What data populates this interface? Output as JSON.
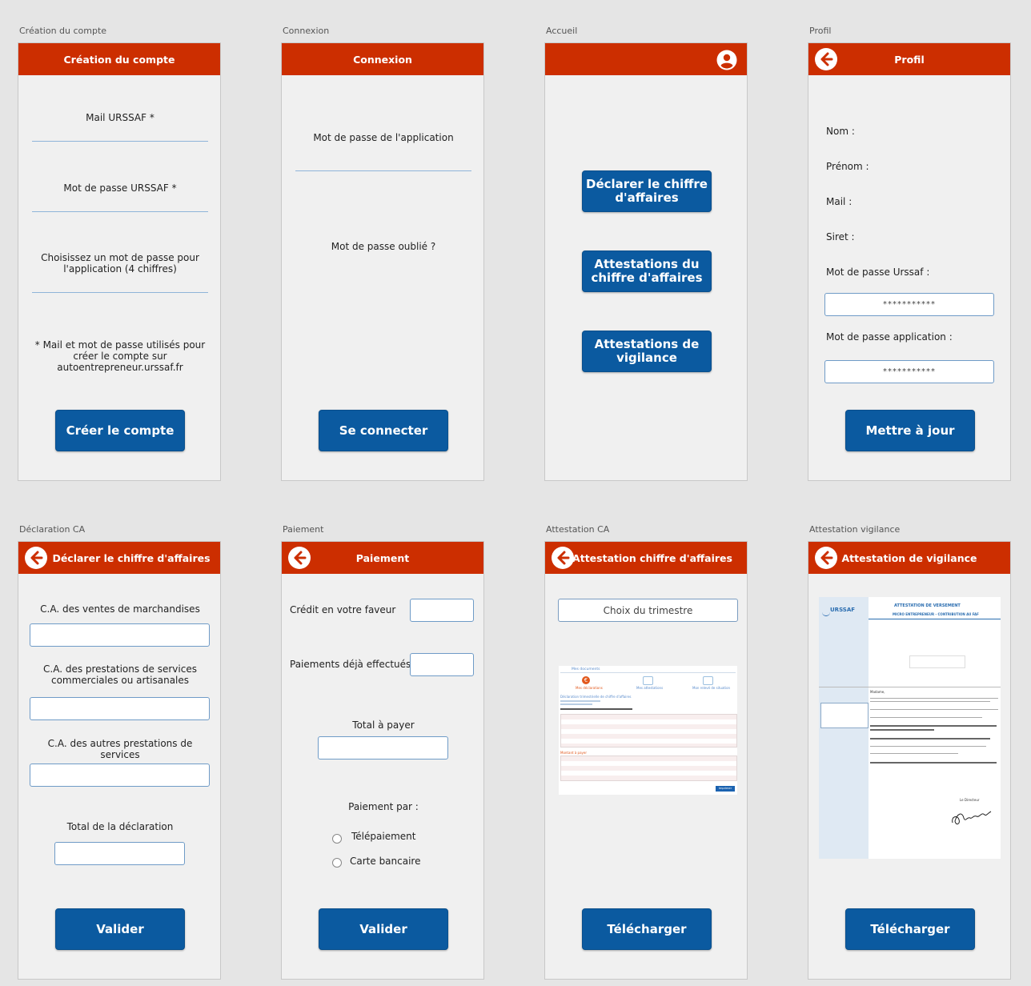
{
  "screens": {
    "creation": {
      "caption": "Création du compte",
      "title": "Création du compte",
      "mail_label": "Mail URSSAF *",
      "pwd_label": "Mot de passe URSSAF *",
      "app_pwd_label": "Choisissez un mot de passe pour l'application (4 chiffres)",
      "note": "* Mail et mot de passe utilisés pour créer le compte sur autoentrepreneur.urssaf.fr",
      "button": "Créer le compte"
    },
    "connexion": {
      "caption": "Connexion",
      "title": "Connexion",
      "pwd_label": "Mot de passe de l'application",
      "forgot": "Mot de passe oublié ?",
      "button": "Se connecter"
    },
    "accueil": {
      "caption": "Accueil",
      "btn1": "Déclarer le chiffre d'affaires",
      "btn2": "Attestations du chiffre d'affaires",
      "btn3": "Attestations de vigilance"
    },
    "profil": {
      "caption": "Profil",
      "title": "Profil",
      "nom": "Nom :",
      "prenom": "Prénom :",
      "mail": "Mail :",
      "siret": "Siret :",
      "pwd_urssaf": "Mot de passe Urssaf :",
      "pwd_urssaf_value": "***********",
      "pwd_app": "Mot de passe application :",
      "pwd_app_value": "***********",
      "button": "Mettre à jour"
    },
    "declaration": {
      "caption": "Déclaration CA",
      "title": "Déclarer le chiffre d'affaires",
      "ventes": "C.A. des ventes de marchandises",
      "prestations": "C.A. des prestations de services commerciales ou artisanales",
      "autres": "C.A. des autres prestations de services",
      "total": "Total de la déclaration",
      "button": "Valider"
    },
    "paiement": {
      "caption": "Paiement",
      "title": "Paiement",
      "credit": "Crédit en votre faveur",
      "deja": "Paiements déjà effectués",
      "total": "Total à payer",
      "par": "Paiement par :",
      "opt1": "Télépaiement",
      "opt2": "Carte bancaire",
      "button": "Valider"
    },
    "attestation_ca": {
      "caption": "Attestation CA",
      "title": "Attestation chiffre d'affaires",
      "select": "Choix du trimestre",
      "button": "Télécharger"
    },
    "attestation_vig": {
      "caption": "Attestation vigilance",
      "title": "Attestation de vigilance",
      "button": "Télécharger"
    }
  },
  "colors": {
    "header": "#cc2e00",
    "button": "#0b5aa0",
    "screen_bg": "#f0f0f0"
  },
  "icons": {
    "back": "arrow-left-circle-icon",
    "account": "account-circle-icon"
  },
  "doc_ca": {
    "heading": "Mes documents",
    "tabs": [
      "Mes déclarations",
      "Mes attestations",
      "Mon relevé de situation"
    ],
    "title": "Déclaration trimestrielle de chiffre d'affaires",
    "total_label": "Montant à payer",
    "button": "Imprimer"
  },
  "doc_vig": {
    "logo": "URSSAF",
    "title": "ATTESTATION DE VERSEMENT",
    "subtitle": "MICRO ENTREPRENEUR - CONTRIBUTION AU FAF",
    "salutation": "Madame,",
    "signature_label": "Le Directeur"
  }
}
